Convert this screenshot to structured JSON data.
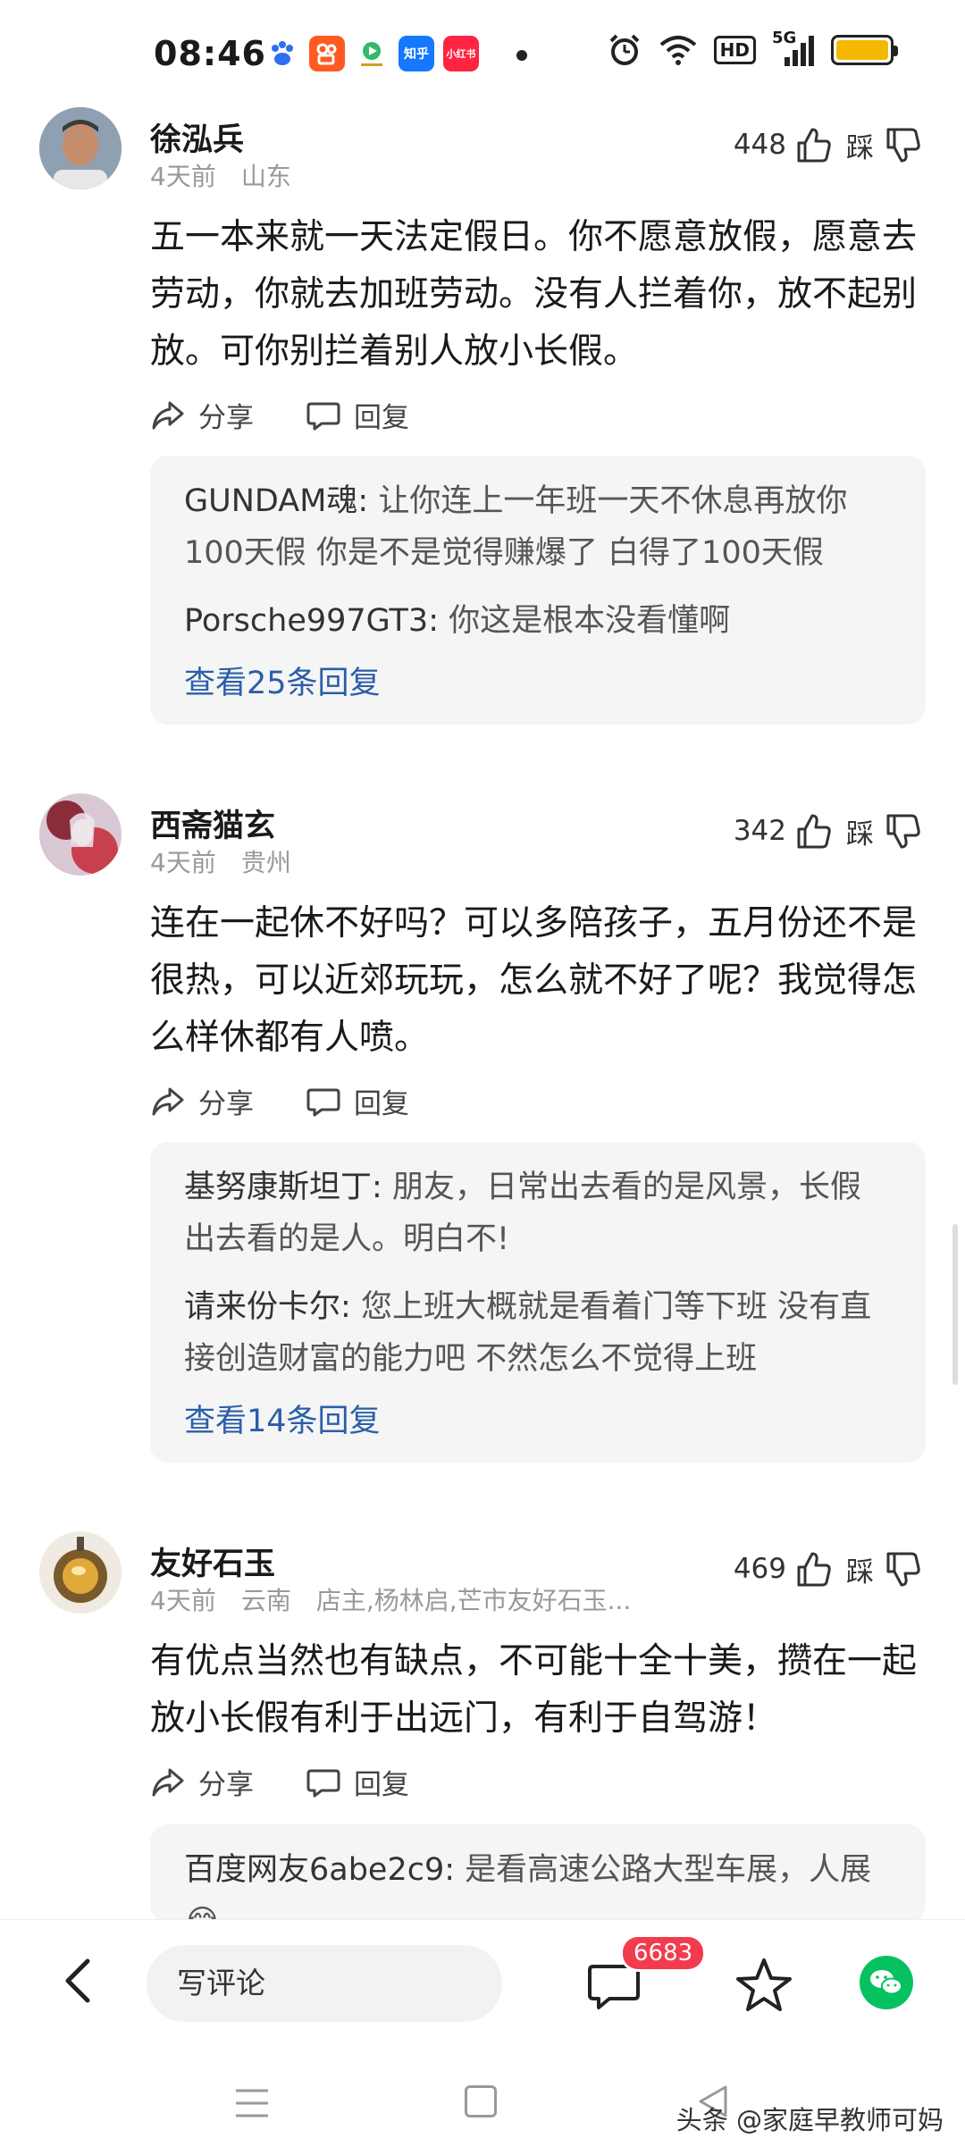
{
  "status_bar": {
    "time": "08:46",
    "apps": [
      {
        "icon": "baidu-paw-icon",
        "label": "",
        "color": "#2f6ef0"
      },
      {
        "icon": "kuaishou-icon",
        "label": "",
        "color": "#ff5a1f"
      },
      {
        "icon": "video-app-icon",
        "label": "",
        "color": "#34b86e"
      },
      {
        "icon": "zhihu-icon",
        "label": "知乎",
        "color": "#1677ff"
      },
      {
        "icon": "xiaohongshu-icon",
        "label": "小红书",
        "color": "#ff2442"
      }
    ],
    "network_label": "5G",
    "hd_label": "HD"
  },
  "comments": [
    {
      "username": "徐泓兵",
      "time": "4天前",
      "location": "山东",
      "extra": "",
      "likes": "448",
      "dislike_label": "踩",
      "content": "五一本来就一天法定假日。你不愿意放假，愿意去劳动，你就去加班劳动。没有人拦着你，放不起别放。可你别拦着别人放小长假。",
      "share_label": "分享",
      "reply_label": "回复",
      "replies": [
        {
          "name": "GUNDAM魂",
          "text": "让你连上一年班一天不休息再放你100天假 你是不是觉得赚爆了 白得了100天假"
        },
        {
          "name": "Porsche997GT3",
          "text": "你这是根本没看懂啊"
        }
      ],
      "more_replies": "查看25条回复"
    },
    {
      "username": "西斋猫玄",
      "time": "4天前",
      "location": "贵州",
      "extra": "",
      "likes": "342",
      "dislike_label": "踩",
      "content": "连在一起休不好吗？可以多陪孩子，五月份还不是很热，可以近郊玩玩，怎么就不好了呢？我觉得怎么样休都有人喷。",
      "share_label": "分享",
      "reply_label": "回复",
      "replies": [
        {
          "name": "基努康斯坦丁",
          "text": "朋友，日常出去看的是风景，长假出去看的是人。明白不!"
        },
        {
          "name": "请来份卡尔",
          "text": "您上班大概就是看着门等下班 没有直接创造财富的能力吧  不然怎么不觉得上班"
        }
      ],
      "more_replies": "查看14条回复"
    },
    {
      "username": "友好石玉",
      "time": "4天前",
      "location": "云南",
      "extra": "店主,杨林启,芒市友好石玉...",
      "likes": "469",
      "dislike_label": "踩",
      "content": "有优点当然也有缺点，不可能十全十美，攒在一起放小长假有利于出远门，有利于自驾游！",
      "share_label": "分享",
      "reply_label": "回复",
      "replies": [
        {
          "name": "百度网友6abe2c9",
          "text": "是看高速公路大型车展，人展😂"
        }
      ],
      "more_replies": ""
    }
  ],
  "bottom_bar": {
    "input_placeholder": "写评论",
    "comment_count": "6683"
  },
  "watermark": "头条 @家庭早教师可妈"
}
